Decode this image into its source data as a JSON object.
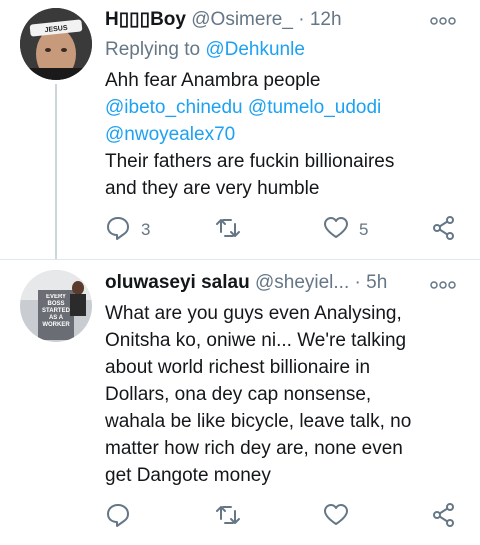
{
  "tweets": [
    {
      "name": "H⁠⁠⁠Boy",
      "name_display": "H▯▯▯Boy",
      "handle": "@Osimere_",
      "time": "12h",
      "reply_prefix": "Replying to",
      "reply_to": "@Dehkunle",
      "text_line1": "Ahh fear Anambra people",
      "mention1": "@ibeto_chinedu",
      "mention2": "@tumelo_udodi",
      "mention3": "@nwoyealex70",
      "text_line2": "Their fathers are fuckin billionaires",
      "text_line3": "and they are very humble",
      "reply_count": "3",
      "retweet_count": "",
      "like_count": "5",
      "avatar_text": "JESUS"
    },
    {
      "name": "oluwaseyi salau",
      "handle": "@sheyiel...",
      "time": "5h",
      "lines": [
        "What are you guys even Analysing,",
        "Onitsha ko, oniwe ni... We're talking",
        "about world richest billionaire in",
        "Dollars, ona dey cap nonsense,",
        "wahala be like bicycle, leave talk, no",
        "matter how rich dey are, none even",
        "get Dangote money"
      ],
      "avatar_text": "EVERY BOSS STARTED AS A WORKER"
    }
  ],
  "separator": "·",
  "colors": {
    "link": "#1da1f2",
    "secondary": "#657786",
    "line": "#ccd6dd"
  },
  "icons": [
    "reply-icon",
    "retweet-icon",
    "like-icon",
    "share-icon",
    "more-icon"
  ]
}
